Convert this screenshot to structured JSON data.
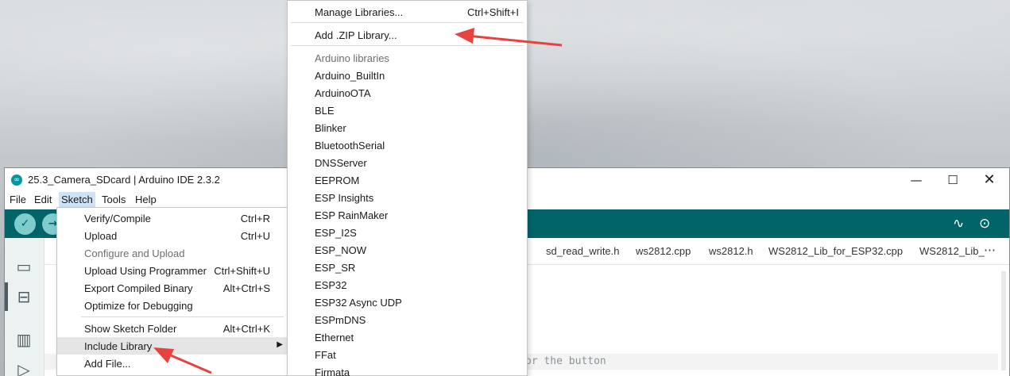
{
  "window": {
    "title": "25.3_Camera_SDcard | Arduino IDE 2.3.2",
    "logo_icon": "arduino-infinity-icon",
    "minimize_icon": "minimize-icon",
    "maximize_icon": "maximize-icon",
    "close_icon": "close-icon"
  },
  "menubar": {
    "items": [
      "File",
      "Edit",
      "Sketch",
      "Tools",
      "Help"
    ],
    "open_item": "Sketch"
  },
  "toolbar": {
    "left_icons": [
      "verify-check-icon",
      "upload-arrow-icon"
    ],
    "right_icons": [
      "serial-plotter-icon",
      "serial-monitor-icon"
    ]
  },
  "sidebar": {
    "icons": [
      "folder-icon",
      "board-icon",
      "library-icon",
      "debug-icon"
    ]
  },
  "tabs": {
    "items": [
      "sd_read_write.h",
      "ws2812.cpp",
      "ws2812.h",
      "WS2812_Lib_for_ESP32.cpp",
      "WS2812_Lib_"
    ],
    "more": "⋯"
  },
  "editor": {
    "visible_code_fragment": "or the button"
  },
  "sketch_menu": {
    "items": [
      {
        "label": "Verify/Compile",
        "shortcut": "Ctrl+R",
        "disabled": false
      },
      {
        "label": "Upload",
        "shortcut": "Ctrl+U",
        "disabled": false
      },
      {
        "label": "Configure and Upload",
        "shortcut": "",
        "disabled": true
      },
      {
        "label": "Upload Using Programmer",
        "shortcut": "Ctrl+Shift+U",
        "disabled": false
      },
      {
        "label": "Export Compiled Binary",
        "shortcut": "Alt+Ctrl+S",
        "disabled": false
      },
      {
        "label": "Optimize for Debugging",
        "shortcut": "",
        "disabled": false
      },
      {
        "label": "Show Sketch Folder",
        "shortcut": "Alt+Ctrl+K",
        "disabled": false
      },
      {
        "label": "Include Library",
        "shortcut": "",
        "disabled": false,
        "submenu": true,
        "highlighted": true
      },
      {
        "label": "Add File...",
        "shortcut": "",
        "disabled": false
      }
    ]
  },
  "library_menu": {
    "manage": {
      "label": "Manage Libraries...",
      "shortcut": "Ctrl+Shift+I"
    },
    "add_zip": {
      "label": "Add .ZIP Library..."
    },
    "section_header": "Arduino libraries",
    "libraries": [
      "Arduino_BuiltIn",
      "ArduinoOTA",
      "BLE",
      "Blinker",
      "BluetoothSerial",
      "DNSServer",
      "EEPROM",
      "ESP Insights",
      "ESP RainMaker",
      "ESP_I2S",
      "ESP_NOW",
      "ESP_SR",
      "ESP32",
      "ESP32 Async UDP",
      "ESPmDNS",
      "Ethernet",
      "FFat",
      "Firmata"
    ]
  },
  "annotations": {
    "arrow_color": "#e8413f"
  },
  "colors": {
    "toolbar": "#006468",
    "toolbar_button": "#7fcbcd",
    "menu_open": "#cfe3f7",
    "menu_hover": "#e5e5e5"
  }
}
